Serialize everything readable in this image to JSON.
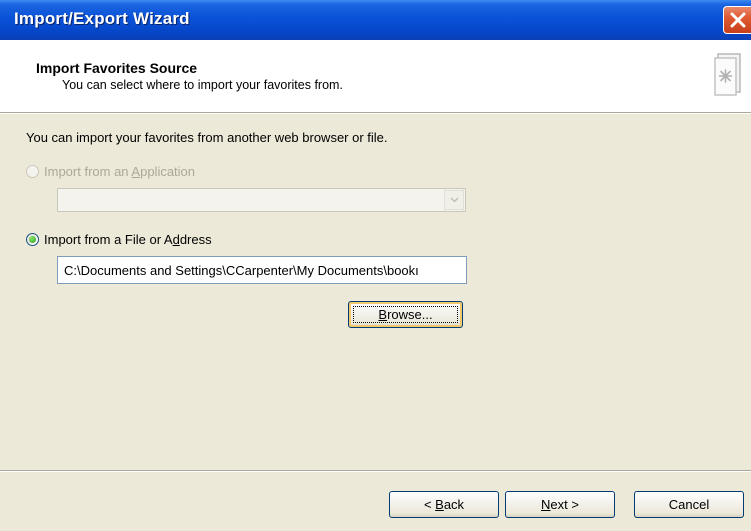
{
  "window": {
    "title": "Import/Export Wizard",
    "close_icon": "close-icon",
    "accent": "#0a52d8"
  },
  "header": {
    "title": "Import Favorites Source",
    "subtitle": "You can select where to import your favorites from.",
    "icon": "wizard-page-icon"
  },
  "body": {
    "intro": "You can import your favorites from another web browser or file.",
    "option_app": {
      "label_pre": "Import from an ",
      "label_accel": "A",
      "label_post": "pplication",
      "enabled": false,
      "checked": false,
      "select_value": ""
    },
    "option_file": {
      "label_pre": "Import from a File or A",
      "label_accel": "d",
      "label_post": "dress",
      "enabled": true,
      "checked": true
    },
    "path_value": "C:\\Documents and Settings\\CCarpenter\\My Documents\\bookı",
    "browse": {
      "accel": "B",
      "rest": "rowse..."
    }
  },
  "footer": {
    "back": {
      "pre": "< ",
      "accel": "B",
      "rest": "ack"
    },
    "next": {
      "accel": "N",
      "rest": "ext >"
    },
    "cancel": "Cancel"
  }
}
